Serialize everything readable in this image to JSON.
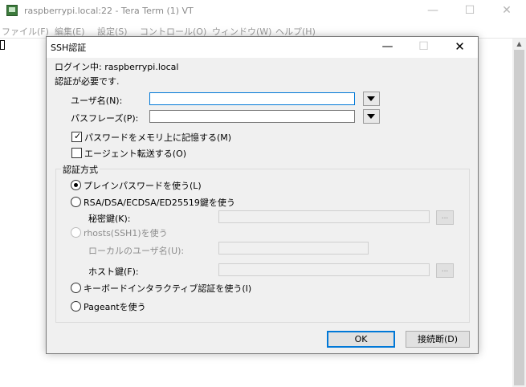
{
  "window": {
    "title": "raspberrypi.local:22 - Tera Term (1) VT",
    "minimize_glyph": "—",
    "maximize_glyph": "☐",
    "close_glyph": "✕",
    "menu": [
      "ファイル(F)",
      "編集(E)",
      "設定(S)",
      "コントロール(O)",
      "ウィンドウ(W)",
      "ヘルプ(H)"
    ]
  },
  "dialog": {
    "title": "SSH認証",
    "minimize_glyph": "—",
    "maximize_glyph": "☐",
    "close_glyph": "✕",
    "login_label": "ログイン中: raspberrypi.local",
    "auth_required": "認証が必要です.",
    "username": {
      "label": "ユーザ名(N):",
      "value": ""
    },
    "passphrase": {
      "label": "パスフレーズ(P):",
      "value": ""
    },
    "remember_password": {
      "label": "パスワードをメモリ上に記憶する(M)",
      "checked": true
    },
    "agent_forwarding": {
      "label": "エージェント転送する(O)",
      "checked": false
    },
    "auth_method": {
      "legend": "認証方式",
      "plain_password": {
        "label": "プレインパスワードを使う(L)",
        "selected": true
      },
      "rsa_key": {
        "label": "RSA/DSA/ECDSA/ED25519鍵を使う",
        "selected": false
      },
      "private_key": {
        "label": "秘密鍵(K):",
        "value": "",
        "browse": "..."
      },
      "rhosts": {
        "label": "rhosts(SSH1)を使う",
        "selected": false,
        "disabled": true
      },
      "local_user": {
        "label": "ローカルのユーザ名(U):",
        "value": ""
      },
      "host_key": {
        "label": "ホスト鍵(F):",
        "value": "",
        "browse": "..."
      },
      "keyboard_interactive": {
        "label": "キーボードインタラクティブ認証を使う(I)",
        "selected": false
      },
      "pageant": {
        "label": "Pageantを使う",
        "selected": false
      }
    },
    "ok_label": "OK",
    "disconnect_label": "接続断(D)"
  }
}
